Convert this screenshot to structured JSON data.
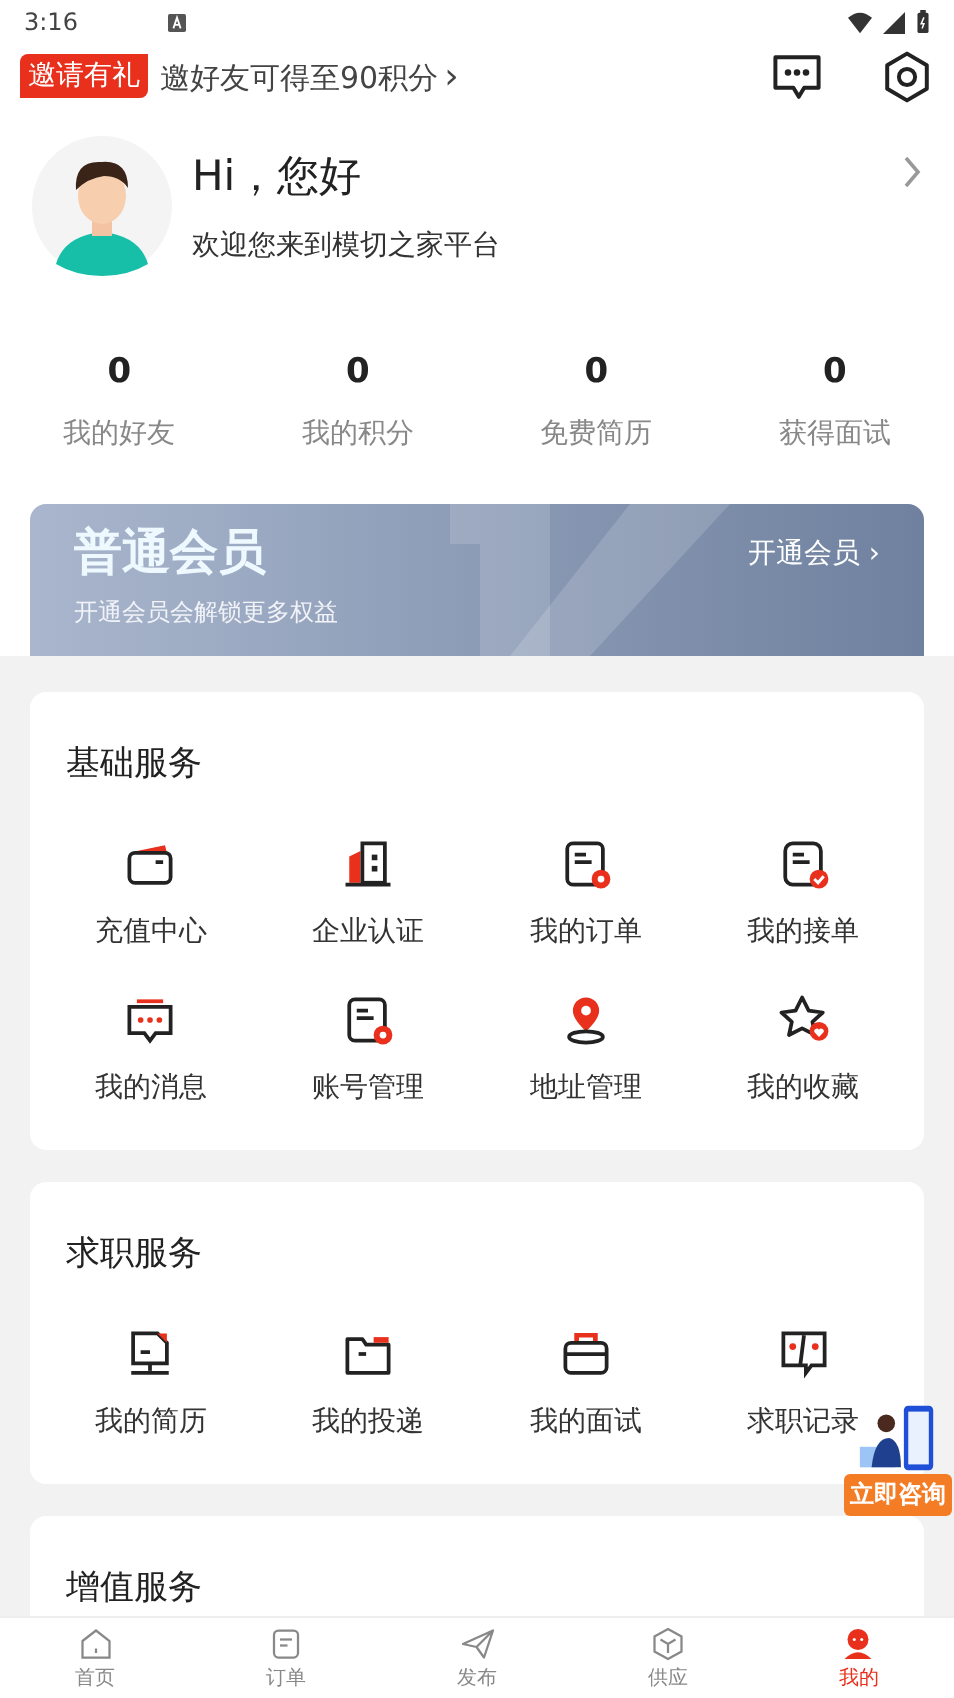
{
  "status_bar": {
    "time": "3:16"
  },
  "invite": {
    "badge": "邀请有礼",
    "text": "邀好友可得至90积分",
    "chevron": "›"
  },
  "profile": {
    "greeting": "Hi，您好",
    "welcome": "欢迎您来到模切之家平台"
  },
  "stats": [
    {
      "value": "0",
      "label": "我的好友"
    },
    {
      "value": "0",
      "label": "我的积分"
    },
    {
      "value": "0",
      "label": "免费简历"
    },
    {
      "value": "0",
      "label": "获得面试"
    }
  ],
  "membership": {
    "title": "普通会员",
    "subtitle": "开通会员会解锁更多权益",
    "action": "开通会员 ›"
  },
  "sections": [
    {
      "title": "基础服务",
      "items": [
        "充值中心",
        "企业认证",
        "我的订单",
        "我的接单",
        "我的消息",
        "账号管理",
        "地址管理",
        "我的收藏"
      ]
    },
    {
      "title": "求职服务",
      "items": [
        "我的简历",
        "我的投递",
        "我的面试",
        "求职记录"
      ]
    },
    {
      "title": "增值服务"
    }
  ],
  "consult_button": "立即咨询",
  "bottom_nav": [
    {
      "label": "首页",
      "selected": false
    },
    {
      "label": "订单",
      "selected": false
    },
    {
      "label": "发布",
      "selected": false
    },
    {
      "label": "供应",
      "selected": false
    },
    {
      "label": "我的",
      "selected": true
    }
  ]
}
